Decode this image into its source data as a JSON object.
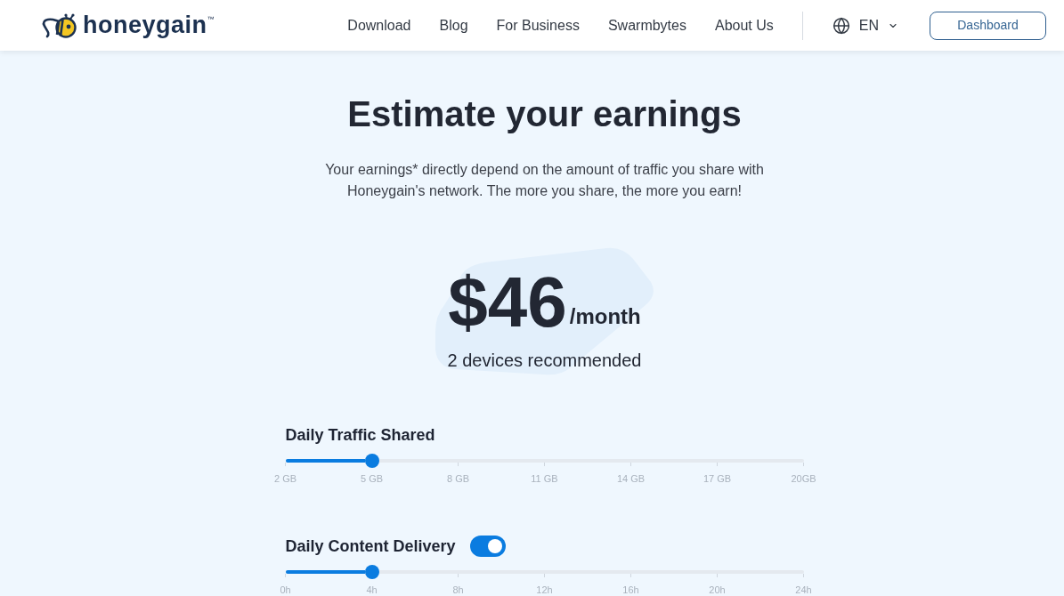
{
  "header": {
    "logo": "honeygain$^{™}$",
    "nav": [
      "Download",
      "Blog",
      "For Business",
      "Swarmbytes",
      "About Us"
    ],
    "language": "EN",
    "dashboard_button": "Dashboard"
  },
  "hero": {
    "title": "Estimate your earnings",
    "description": "Your earnings* directly depend on the amount of traffic you share with Honeygain's network. The more you share, the more you earn!",
    "price": "$46",
    "period": "/month",
    "devices": "2 devices recommended"
  },
  "controls": [
    {
      "label": "Daily Traffic Shared",
      "level": 0.1667,
      "ticks": [
        "2 GB",
        "5 GB",
        "8 GB",
        "11 GB",
        "14 GB",
        "17 GB",
        "20GB"
      ]
    },
    {
      "label": "Daily Content Delivery",
      "toggle": {
        "on": true
      },
      "level": 0.1667,
      "ticks": [
        "0h",
        "4h",
        "8h",
        "12h",
        "16h",
        "20h",
        "24h"
      ]
    }
  ]
}
